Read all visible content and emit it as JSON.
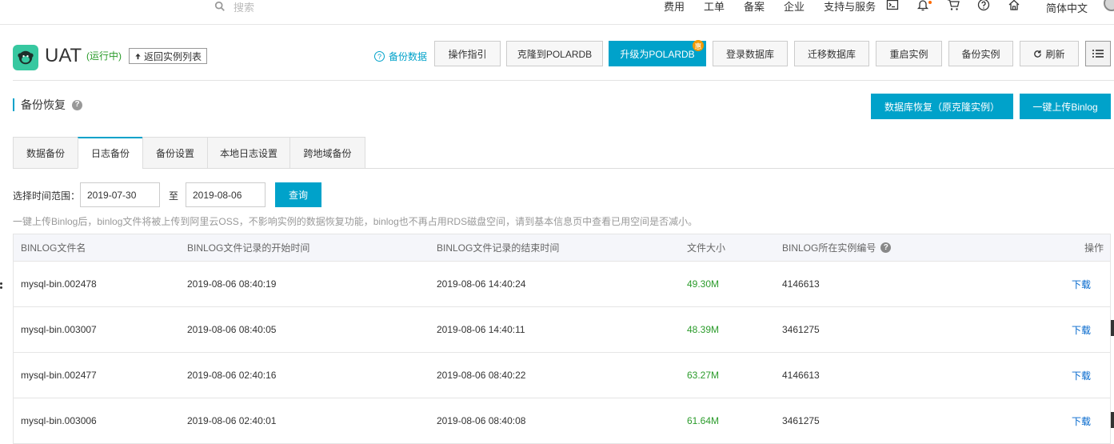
{
  "topnav": {
    "search_placeholder": "搜索",
    "links": [
      "费用",
      "工单",
      "备案",
      "企业",
      "支持与服务"
    ],
    "language": "简体中文"
  },
  "header": {
    "instance_name": "UAT",
    "status": "(运行中)",
    "back_label": "返回实例列表",
    "backup_data_label": "备份数据",
    "buttons": {
      "guide": "操作指引",
      "clone": "克隆到POLARDB",
      "upgrade": "升级为POLARDB",
      "upgrade_badge": "惠",
      "login": "登录数据库",
      "migrate": "迁移数据库",
      "restart": "重启实例",
      "backup": "备份实例",
      "refresh": "刷新"
    }
  },
  "section": {
    "title": "备份恢复",
    "restore_button": "数据库恢复（原克隆实例）",
    "upload_button": "一键上传Binlog"
  },
  "tabs": [
    "数据备份",
    "日志备份",
    "备份设置",
    "本地日志设置",
    "跨地域备份"
  ],
  "filter": {
    "label": "选择时间范围：",
    "start": "2019-07-30",
    "to": "至",
    "end": "2019-08-06",
    "query": "查询"
  },
  "notice": "一键上传Binlog后，binlog文件将被上传到阿里云OSS，不影响实例的数据恢复功能，binlog也不再占用RDS磁盘空间，请到基本信息页中查看已用空间是否减小。",
  "table": {
    "headers": {
      "name": "BINLOG文件名",
      "start": "BINLOG文件记录的开始时间",
      "end": "BINLOG文件记录的结束时间",
      "size": "文件大小",
      "instance": "BINLOG所在实例编号",
      "action": "操作"
    },
    "rows": [
      {
        "name": "mysql-bin.002478",
        "start": "2019-08-06 08:40:19",
        "end": "2019-08-06 14:40:24",
        "size": "49.30M",
        "instance": "4146613",
        "action": "下载"
      },
      {
        "name": "mysql-bin.003007",
        "start": "2019-08-06 08:40:05",
        "end": "2019-08-06 14:40:11",
        "size": "48.39M",
        "instance": "3461275",
        "action": "下载"
      },
      {
        "name": "mysql-bin.002477",
        "start": "2019-08-06 02:40:16",
        "end": "2019-08-06 08:40:22",
        "size": "63.27M",
        "instance": "4146613",
        "action": "下载"
      },
      {
        "name": "mysql-bin.003006",
        "start": "2019-08-06 02:40:01",
        "end": "2019-08-06 08:40:08",
        "size": "61.64M",
        "instance": "3461275",
        "action": "下载"
      }
    ]
  }
}
